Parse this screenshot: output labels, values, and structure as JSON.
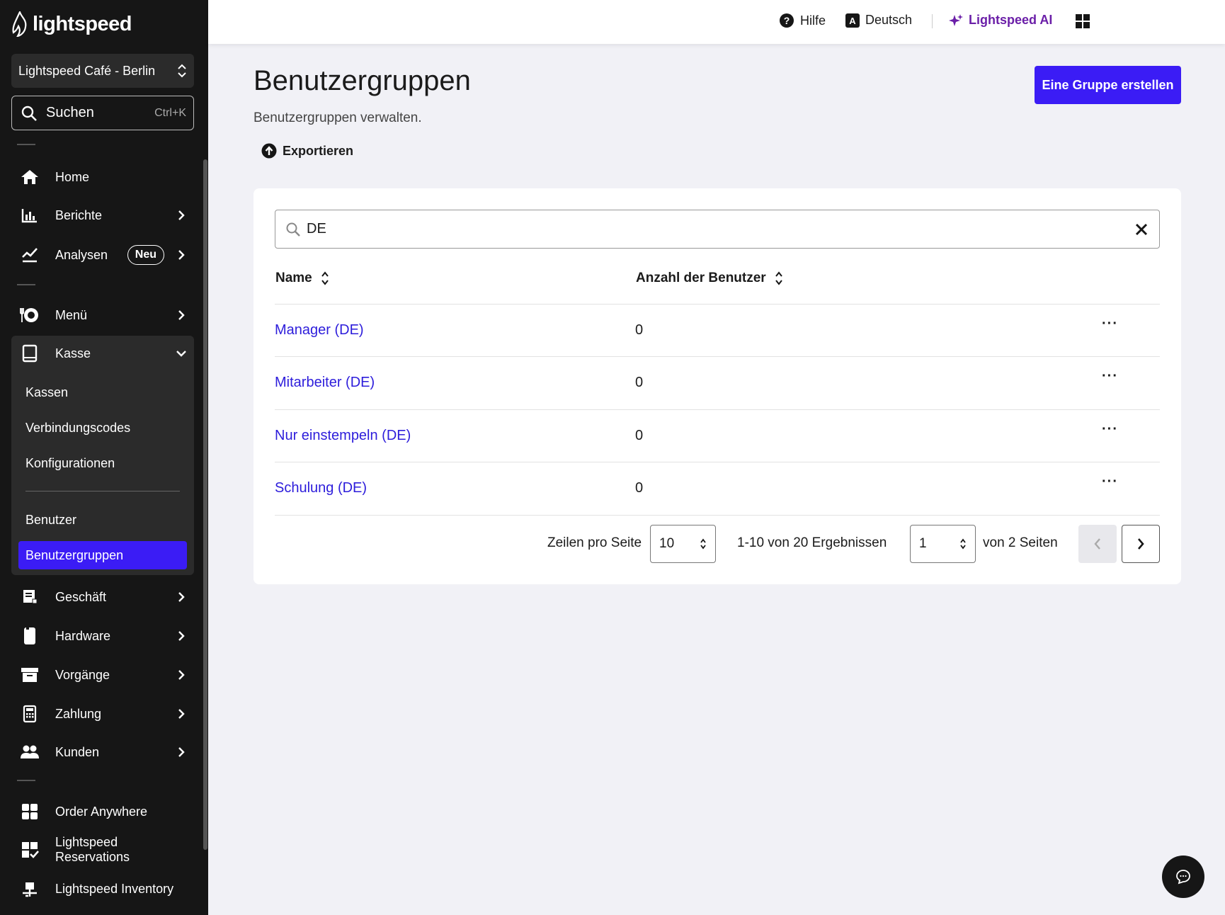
{
  "brand": {
    "logo_text": "lightspeed"
  },
  "sidebar": {
    "location": "Lightspeed Café - Berlin",
    "search_label": "Suchen",
    "search_shortcut": "Ctrl+K",
    "items": {
      "home": "Home",
      "berichte": "Berichte",
      "analysen": "Analysen",
      "analysen_badge": "Neu",
      "menue": "Menü",
      "kasse": "Kasse",
      "geschaeft": "Geschäft",
      "hardware": "Hardware",
      "vorgaenge": "Vorgänge",
      "zahlung": "Zahlung",
      "kunden": "Kunden",
      "order_anywhere": "Order Anywhere",
      "reservations": "Lightspeed Reservations",
      "inventory": "Lightspeed Inventory"
    },
    "kasse_sub": {
      "kassen": "Kassen",
      "verbindungscodes": "Verbindungscodes",
      "konfigurationen": "Konfigurationen",
      "benutzer": "Benutzer",
      "benutzergruppen": "Benutzergruppen"
    }
  },
  "topbar": {
    "help": "Hilfe",
    "language": "Deutsch",
    "ai": "Lightspeed AI"
  },
  "page": {
    "title": "Benutzergruppen",
    "subtitle": "Benutzergruppen verwalten.",
    "export": "Exportieren",
    "create_button": "Eine Gruppe erstellen"
  },
  "table": {
    "filter_value": "DE",
    "col_name": "Name",
    "col_count": "Anzahl der Benutzer",
    "rows": [
      {
        "name": "Manager (DE)",
        "count": "0"
      },
      {
        "name": "Mitarbeiter (DE)",
        "count": "0"
      },
      {
        "name": "Nur einstempeln (DE)",
        "count": "0"
      },
      {
        "name": "Schulung (DE)",
        "count": "0"
      }
    ],
    "more": "···"
  },
  "pagination": {
    "rows_label": "Zeilen pro Seite",
    "rows_value": "10",
    "results": "1-10 von 20 Ergebnissen",
    "page_value": "1",
    "pages_label": "von 2 Seiten"
  },
  "colors": {
    "accent": "#3b1cf5",
    "link": "#2d1ddb",
    "ai": "#6b1fa8",
    "sidebar_bg": "#161616"
  }
}
